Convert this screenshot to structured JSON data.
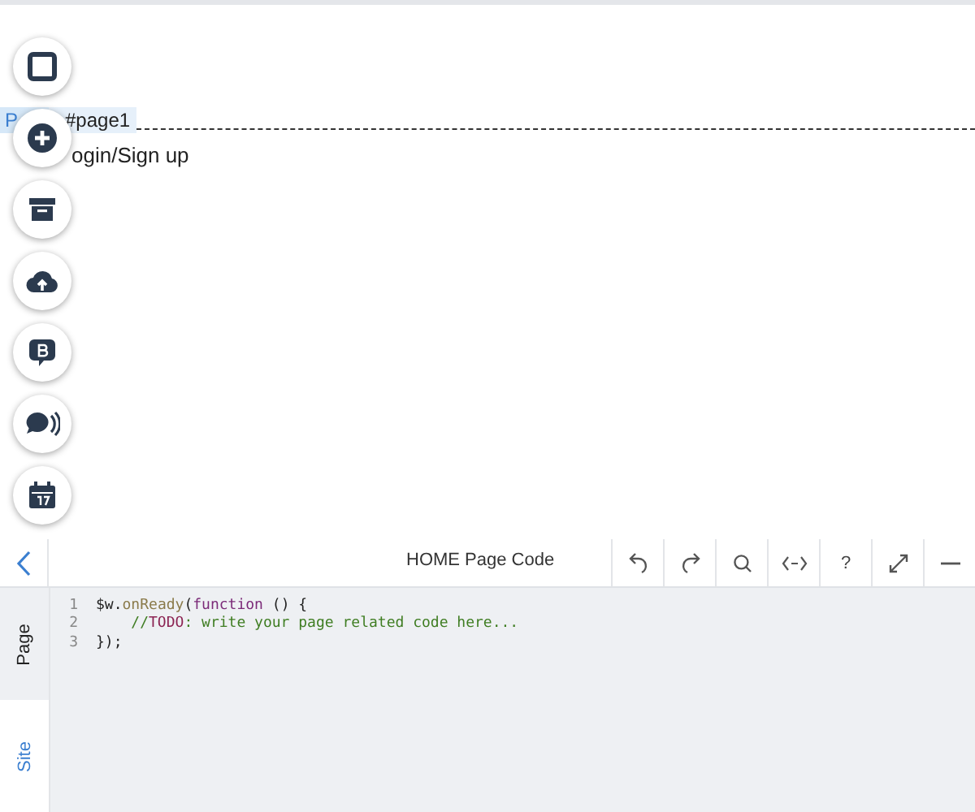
{
  "canvas": {
    "page_tag": "P",
    "anchor": "#page1",
    "text": "ogin/Sign up"
  },
  "editor": {
    "title": "HOME Page Code",
    "help_label": "?",
    "side_tabs": [
      {
        "label": "Page",
        "selected": true
      },
      {
        "label": "Site",
        "selected": false
      }
    ],
    "lines": [
      {
        "number": "1",
        "tokens": [
          {
            "kind": "plain",
            "text": "$w."
          },
          {
            "kind": "method",
            "text": "onReady"
          },
          {
            "kind": "plain",
            "text": "("
          },
          {
            "kind": "keyword",
            "text": "function"
          },
          {
            "kind": "plain",
            "text": " () {"
          }
        ]
      },
      {
        "number": "2",
        "indented": true,
        "tokens": [
          {
            "kind": "comment",
            "text": "//"
          },
          {
            "kind": "todo",
            "text": "TODO"
          },
          {
            "kind": "comment",
            "text": ": write your page related code here..."
          }
        ]
      },
      {
        "number": "3",
        "tokens": [
          {
            "kind": "plain",
            "text": "});"
          }
        ]
      }
    ]
  }
}
